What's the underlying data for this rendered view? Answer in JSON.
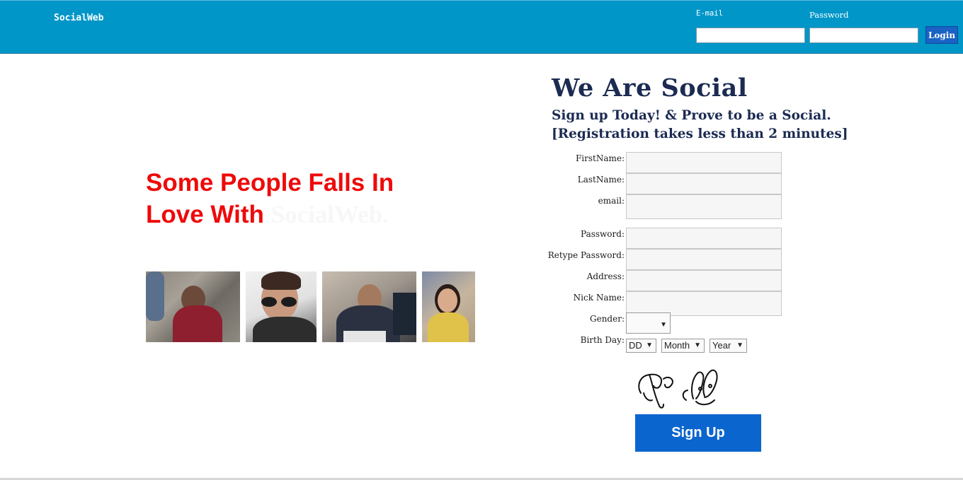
{
  "header": {
    "brand": "SocialWeb",
    "email_label": "E-mail",
    "password_label": "Password",
    "email_value": "",
    "password_value": "",
    "login_label": "Login"
  },
  "hero": {
    "tagline_line1": "Some People Falls In",
    "tagline_line2": "Love With",
    "tagline_faint": "SocialWeb."
  },
  "signup": {
    "title": "We Are Social",
    "subtitle": "Sign up Today! & Prove to be a Social.[Registration takes less than 2 minutes]",
    "labels": {
      "first_name": "FirstName:",
      "last_name": "LastName:",
      "email": "email:",
      "password": "Password:",
      "retype_password": "Retype Password:",
      "address": "Address:",
      "nick_name": "Nick Name:",
      "gender": "Gender:",
      "birth_day": "Birth Day:"
    },
    "gender_value": "",
    "birth_day": {
      "day": "DD",
      "month": "Month",
      "year": "Year"
    },
    "button_label": "Sign Up"
  },
  "colors": {
    "header_bg": "#0096c8",
    "login_btn": "#1a62c4",
    "tagline": "#ee0a0a",
    "heading": "#1c2b52",
    "signup_btn": "#0b65cf"
  }
}
